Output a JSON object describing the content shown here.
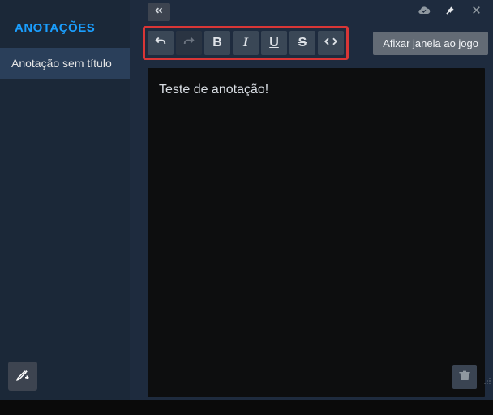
{
  "sidebar": {
    "title": "ANOTAÇÕES",
    "items": [
      {
        "label": "Anotação sem título"
      }
    ],
    "add_icon": "pencil-plus"
  },
  "topbar": {
    "collapse_icon": "chevrons-left",
    "cloud_icon": "cloud-check",
    "pin_icon": "pin",
    "close_icon": "close"
  },
  "toolbar": {
    "undo": "undo",
    "redo": "redo",
    "bold": "B",
    "italic": "I",
    "underline": "U",
    "strike": "S",
    "code": "code",
    "pin_button": "Afixar janela ao jogo"
  },
  "editor": {
    "content": "Teste de anotação!"
  },
  "actions": {
    "trash": "trash"
  }
}
